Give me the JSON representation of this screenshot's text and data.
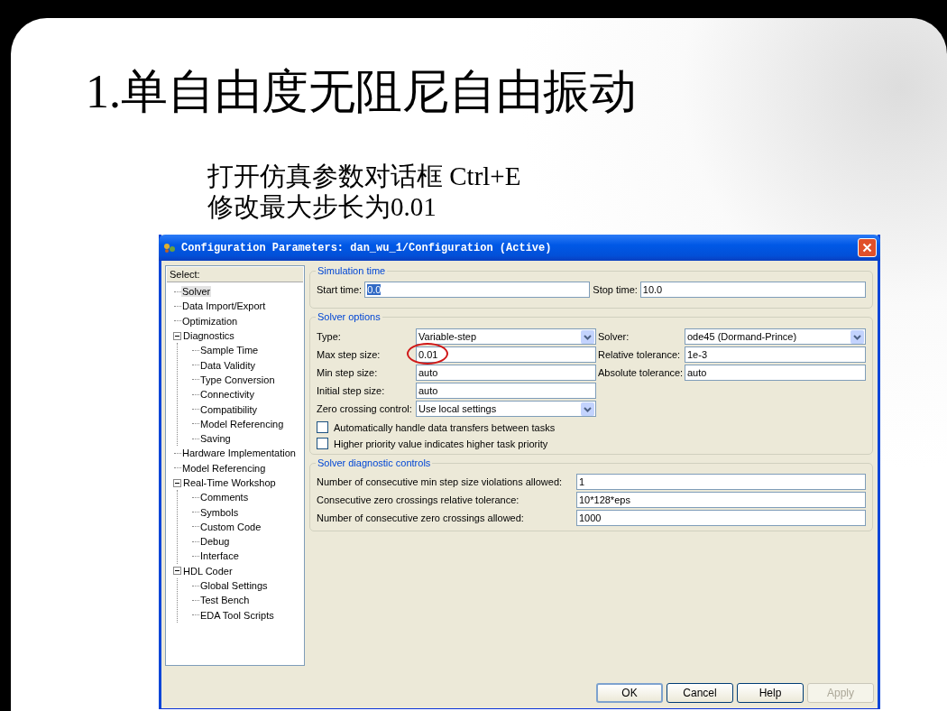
{
  "slide": {
    "title": "1.单自由度无阻尼自由振动",
    "subtitle_lines": [
      "打开仿真参数对话框 Ctrl+E",
      "修改最大步长为0.01"
    ]
  },
  "window": {
    "title": "Configuration Parameters: dan_wu_1/Configuration (Active)"
  },
  "sidebar": {
    "header": "Select:",
    "items": [
      {
        "label": "Solver",
        "selected": true
      },
      {
        "label": "Data Import/Export",
        "selected": false
      },
      {
        "label": "Optimization",
        "selected": false
      },
      {
        "label": "Diagnostics",
        "selected": false,
        "expanded": true,
        "children": [
          {
            "label": "Sample Time",
            "selected": false
          },
          {
            "label": "Data Validity",
            "selected": false
          },
          {
            "label": "Type Conversion",
            "selected": false
          },
          {
            "label": "Connectivity",
            "selected": false
          },
          {
            "label": "Compatibility",
            "selected": false
          },
          {
            "label": "Model Referencing",
            "selected": false
          },
          {
            "label": "Saving",
            "selected": false
          }
        ]
      },
      {
        "label": "Hardware Implementation",
        "selected": false
      },
      {
        "label": "Model Referencing",
        "selected": false
      },
      {
        "label": "Real-Time Workshop",
        "selected": false,
        "expanded": true,
        "children": [
          {
            "label": "Comments",
            "selected": false
          },
          {
            "label": "Symbols",
            "selected": false
          },
          {
            "label": "Custom Code",
            "selected": false
          },
          {
            "label": "Debug",
            "selected": false
          },
          {
            "label": "Interface",
            "selected": false
          }
        ]
      },
      {
        "label": "HDL Coder",
        "selected": false,
        "expanded": true,
        "children": [
          {
            "label": "Global Settings",
            "selected": false
          },
          {
            "label": "Test Bench",
            "selected": false
          },
          {
            "label": "EDA Tool Scripts",
            "selected": false
          }
        ]
      }
    ]
  },
  "sections": [
    {
      "title": "Simulation time",
      "fields": [
        {
          "kind": "text",
          "label": "Start time:",
          "value": "0.0",
          "text_selected": true
        },
        {
          "kind": "text",
          "label": "Stop time:",
          "value": "10.0",
          "text_selected": false
        }
      ]
    },
    {
      "title": "Solver options",
      "fields": [
        {
          "kind": "dropdown",
          "label": "Type:",
          "value": "Variable-step"
        },
        {
          "kind": "dropdown",
          "label": "Solver:",
          "value": "ode45 (Dormand-Prince)"
        },
        {
          "kind": "text",
          "label": "Max step size:",
          "value": "0.01",
          "text_selected": false,
          "circled": true
        },
        {
          "kind": "text",
          "label": "Relative tolerance:",
          "value": "1e-3",
          "text_selected": false
        },
        {
          "kind": "text",
          "label": "Min step size:",
          "value": "auto",
          "text_selected": false
        },
        {
          "kind": "text",
          "label": "Absolute tolerance:",
          "value": "auto",
          "text_selected": false
        },
        {
          "kind": "text",
          "label": "Initial step size:",
          "value": "auto",
          "text_selected": false
        },
        {
          "kind": "blank"
        },
        {
          "kind": "dropdown",
          "label": "Zero crossing control:",
          "value": "Use local settings"
        },
        {
          "kind": "blank"
        },
        {
          "kind": "checkbox",
          "label": "Automatically handle data transfers between tasks",
          "checked": false
        },
        {
          "kind": "checkbox",
          "label": "Higher priority value indicates higher task priority",
          "checked": false
        }
      ]
    },
    {
      "title": "Solver diagnostic controls",
      "fields": [
        {
          "kind": "text",
          "label": "Number of consecutive min step size violations allowed:",
          "value": "1",
          "text_selected": false
        },
        {
          "kind": "text",
          "label": "Consecutive zero crossings relative tolerance:",
          "value": "10*128*eps",
          "text_selected": false
        },
        {
          "kind": "text",
          "label": "Number of consecutive zero crossings allowed:",
          "value": "1000",
          "text_selected": false
        }
      ]
    }
  ],
  "buttons": [
    {
      "label": "OK",
      "disabled": false
    },
    {
      "label": "Cancel",
      "disabled": false
    },
    {
      "label": "Help",
      "disabled": false
    },
    {
      "label": "Apply",
      "disabled": true
    }
  ]
}
